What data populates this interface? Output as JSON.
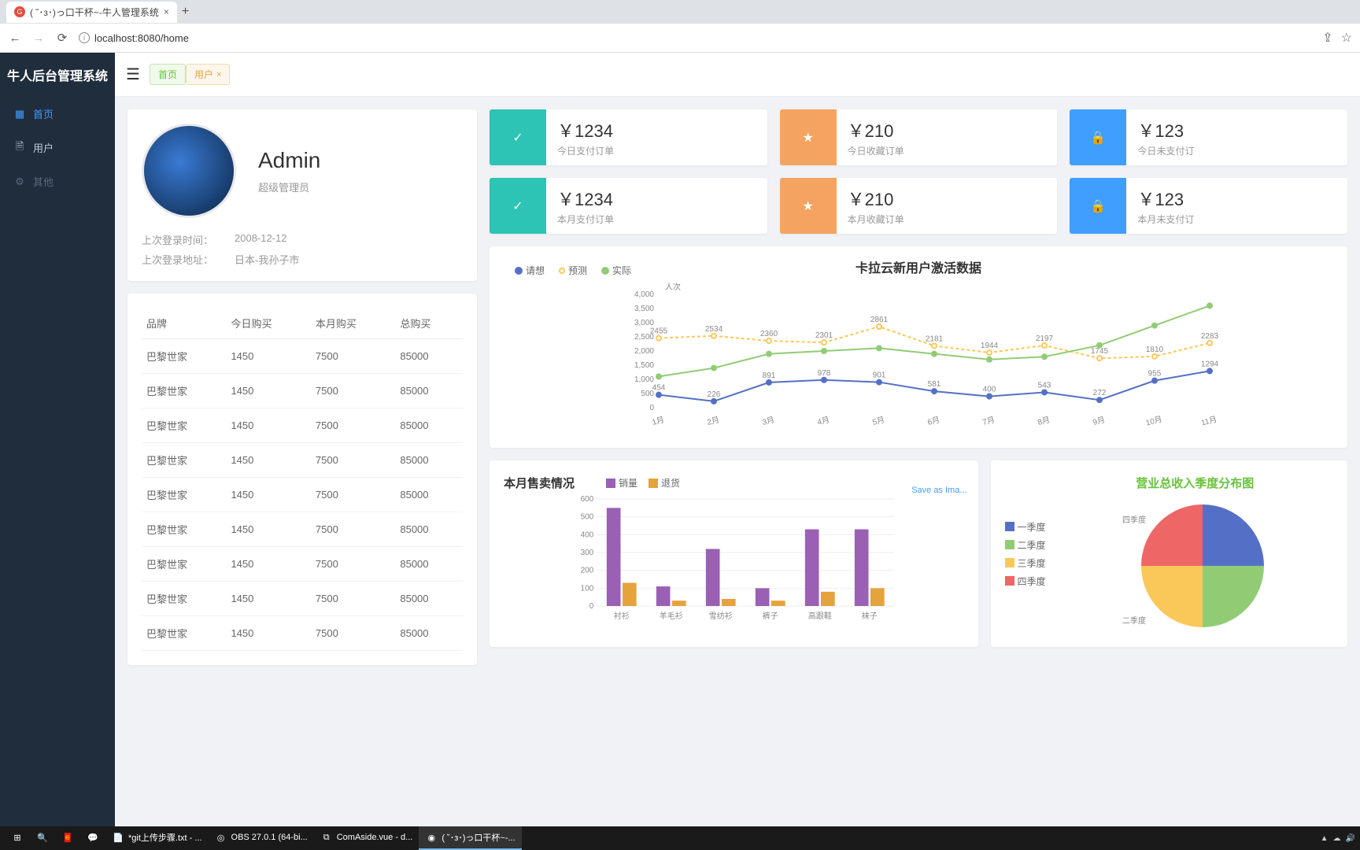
{
  "browser": {
    "tab_title": "( ˘･з･)っ口干杯~-牛人管理系统",
    "url": "localhost:8080/home",
    "share_label": "",
    "star_label": ""
  },
  "app_title": "牛人后台管理系统",
  "sidebar": {
    "items": [
      {
        "label": "首页",
        "icon": "grid-icon",
        "active": true
      },
      {
        "label": "用户",
        "icon": "doc-icon",
        "active": false
      },
      {
        "label": "其他",
        "icon": "gear-icon",
        "active": false,
        "dim": true
      }
    ]
  },
  "tabs": [
    {
      "label": "首页",
      "variant": "green",
      "closable": false
    },
    {
      "label": "用户",
      "variant": "orange",
      "closable": true
    }
  ],
  "profile": {
    "name": "Admin",
    "role": "超级管理员",
    "meta": [
      {
        "label": "上次登录时间：",
        "value": "2008-12-12"
      },
      {
        "label": "上次登录地址：",
        "value": "日本-我孙子市"
      }
    ]
  },
  "brand_table": {
    "headers": [
      "品牌",
      "今日购买",
      "本月购买",
      "总购买"
    ],
    "rows": [
      [
        "巴黎世家",
        "1450",
        "7500",
        "85000"
      ],
      [
        "巴黎世家",
        "1450",
        "7500",
        "85000"
      ],
      [
        "巴黎世家",
        "1450",
        "7500",
        "85000"
      ],
      [
        "巴黎世家",
        "1450",
        "7500",
        "85000"
      ],
      [
        "巴黎世家",
        "1450",
        "7500",
        "85000"
      ],
      [
        "巴黎世家",
        "1450",
        "7500",
        "85000"
      ],
      [
        "巴黎世家",
        "1450",
        "7500",
        "85000"
      ],
      [
        "巴黎世家",
        "1450",
        "7500",
        "85000"
      ],
      [
        "巴黎世家",
        "1450",
        "7500",
        "85000"
      ]
    ]
  },
  "stats": {
    "row1": [
      {
        "value": "￥1234",
        "label": "今日支付订单",
        "color": "teal",
        "icon": "check"
      },
      {
        "value": "￥210",
        "label": "今日收藏订单",
        "color": "orange",
        "icon": "star"
      },
      {
        "value": "￥123",
        "label": "今日未支付订",
        "color": "blue",
        "icon": "bag"
      }
    ],
    "row2": [
      {
        "value": "￥1234",
        "label": "本月支付订单",
        "color": "teal",
        "icon": "check"
      },
      {
        "value": "￥210",
        "label": "本月收藏订单",
        "color": "orange",
        "icon": "star"
      },
      {
        "value": "￥123",
        "label": "本月未支付订",
        "color": "blue",
        "icon": "bag"
      }
    ]
  },
  "chart_data": [
    {
      "id": "line_chart",
      "type": "line",
      "title": "卡拉云新用户激活数据",
      "ylabel": "人次",
      "ylim": [
        0,
        4000
      ],
      "yticks": [
        0,
        500,
        1000,
        1500,
        2000,
        2500,
        3000,
        3500,
        4000
      ],
      "categories": [
        "1月",
        "2月",
        "3月",
        "4月",
        "5月",
        "6月",
        "7月",
        "8月",
        "9月",
        "10月",
        "11月"
      ],
      "legend": [
        "请想",
        "预测",
        "实际"
      ],
      "series": [
        {
          "name": "请想",
          "color": "#5470c6",
          "values": [
            454,
            226,
            891,
            978,
            901,
            581,
            400,
            543,
            272,
            955,
            1294
          ]
        },
        {
          "name": "预测",
          "color": "#fac858",
          "values": [
            2455,
            2534,
            2360,
            2301,
            2861,
            2181,
            1944,
            2197,
            1745,
            1810,
            2283
          ]
        },
        {
          "name": "实际",
          "color": "#91cc75",
          "values": [
            1100,
            1400,
            1900,
            2000,
            2100,
            1900,
            1700,
            1800,
            2200,
            2900,
            3600
          ]
        }
      ]
    },
    {
      "id": "bar_chart",
      "type": "bar",
      "title": "本月售卖情况",
      "ylim": [
        0,
        600
      ],
      "yticks": [
        0,
        100,
        200,
        300,
        400,
        500,
        600
      ],
      "categories": [
        "衬衫",
        "羊毛衫",
        "雪纺衫",
        "裤子",
        "高跟鞋",
        "袜子"
      ],
      "legend": [
        "销量",
        "退货"
      ],
      "save_as": "Save as Ima...",
      "series": [
        {
          "name": "销量",
          "color": "#9a60b4",
          "values": [
            550,
            110,
            320,
            100,
            430,
            430
          ]
        },
        {
          "name": "退货",
          "color": "#e6a23c",
          "values": [
            130,
            30,
            40,
            30,
            80,
            100
          ]
        }
      ]
    },
    {
      "id": "pie_chart",
      "type": "pie",
      "title": "营业总收入季度分布图",
      "legend": [
        "一季度",
        "二季度",
        "三季度",
        "四季度"
      ],
      "colors": [
        "#5470c6",
        "#91cc75",
        "#fac858",
        "#ee6666"
      ],
      "values": [
        25,
        25,
        25,
        25
      ],
      "labels_shown": [
        "四季度",
        "二季度"
      ]
    }
  ],
  "taskbar": {
    "items": [
      {
        "label": "",
        "icon": "win"
      },
      {
        "label": "",
        "icon": "search"
      },
      {
        "label": "",
        "icon": "gourd"
      },
      {
        "label": "",
        "icon": "wechat"
      },
      {
        "label": "*git上传步骤.txt - ...",
        "icon": "notepad"
      },
      {
        "label": "OBS 27.0.1 (64-bi...",
        "icon": "obs"
      },
      {
        "label": "ComAside.vue - d...",
        "icon": "vscode"
      },
      {
        "label": "( ˘･з･)っ口干杯~-...",
        "icon": "chrome",
        "active": true
      }
    ]
  }
}
